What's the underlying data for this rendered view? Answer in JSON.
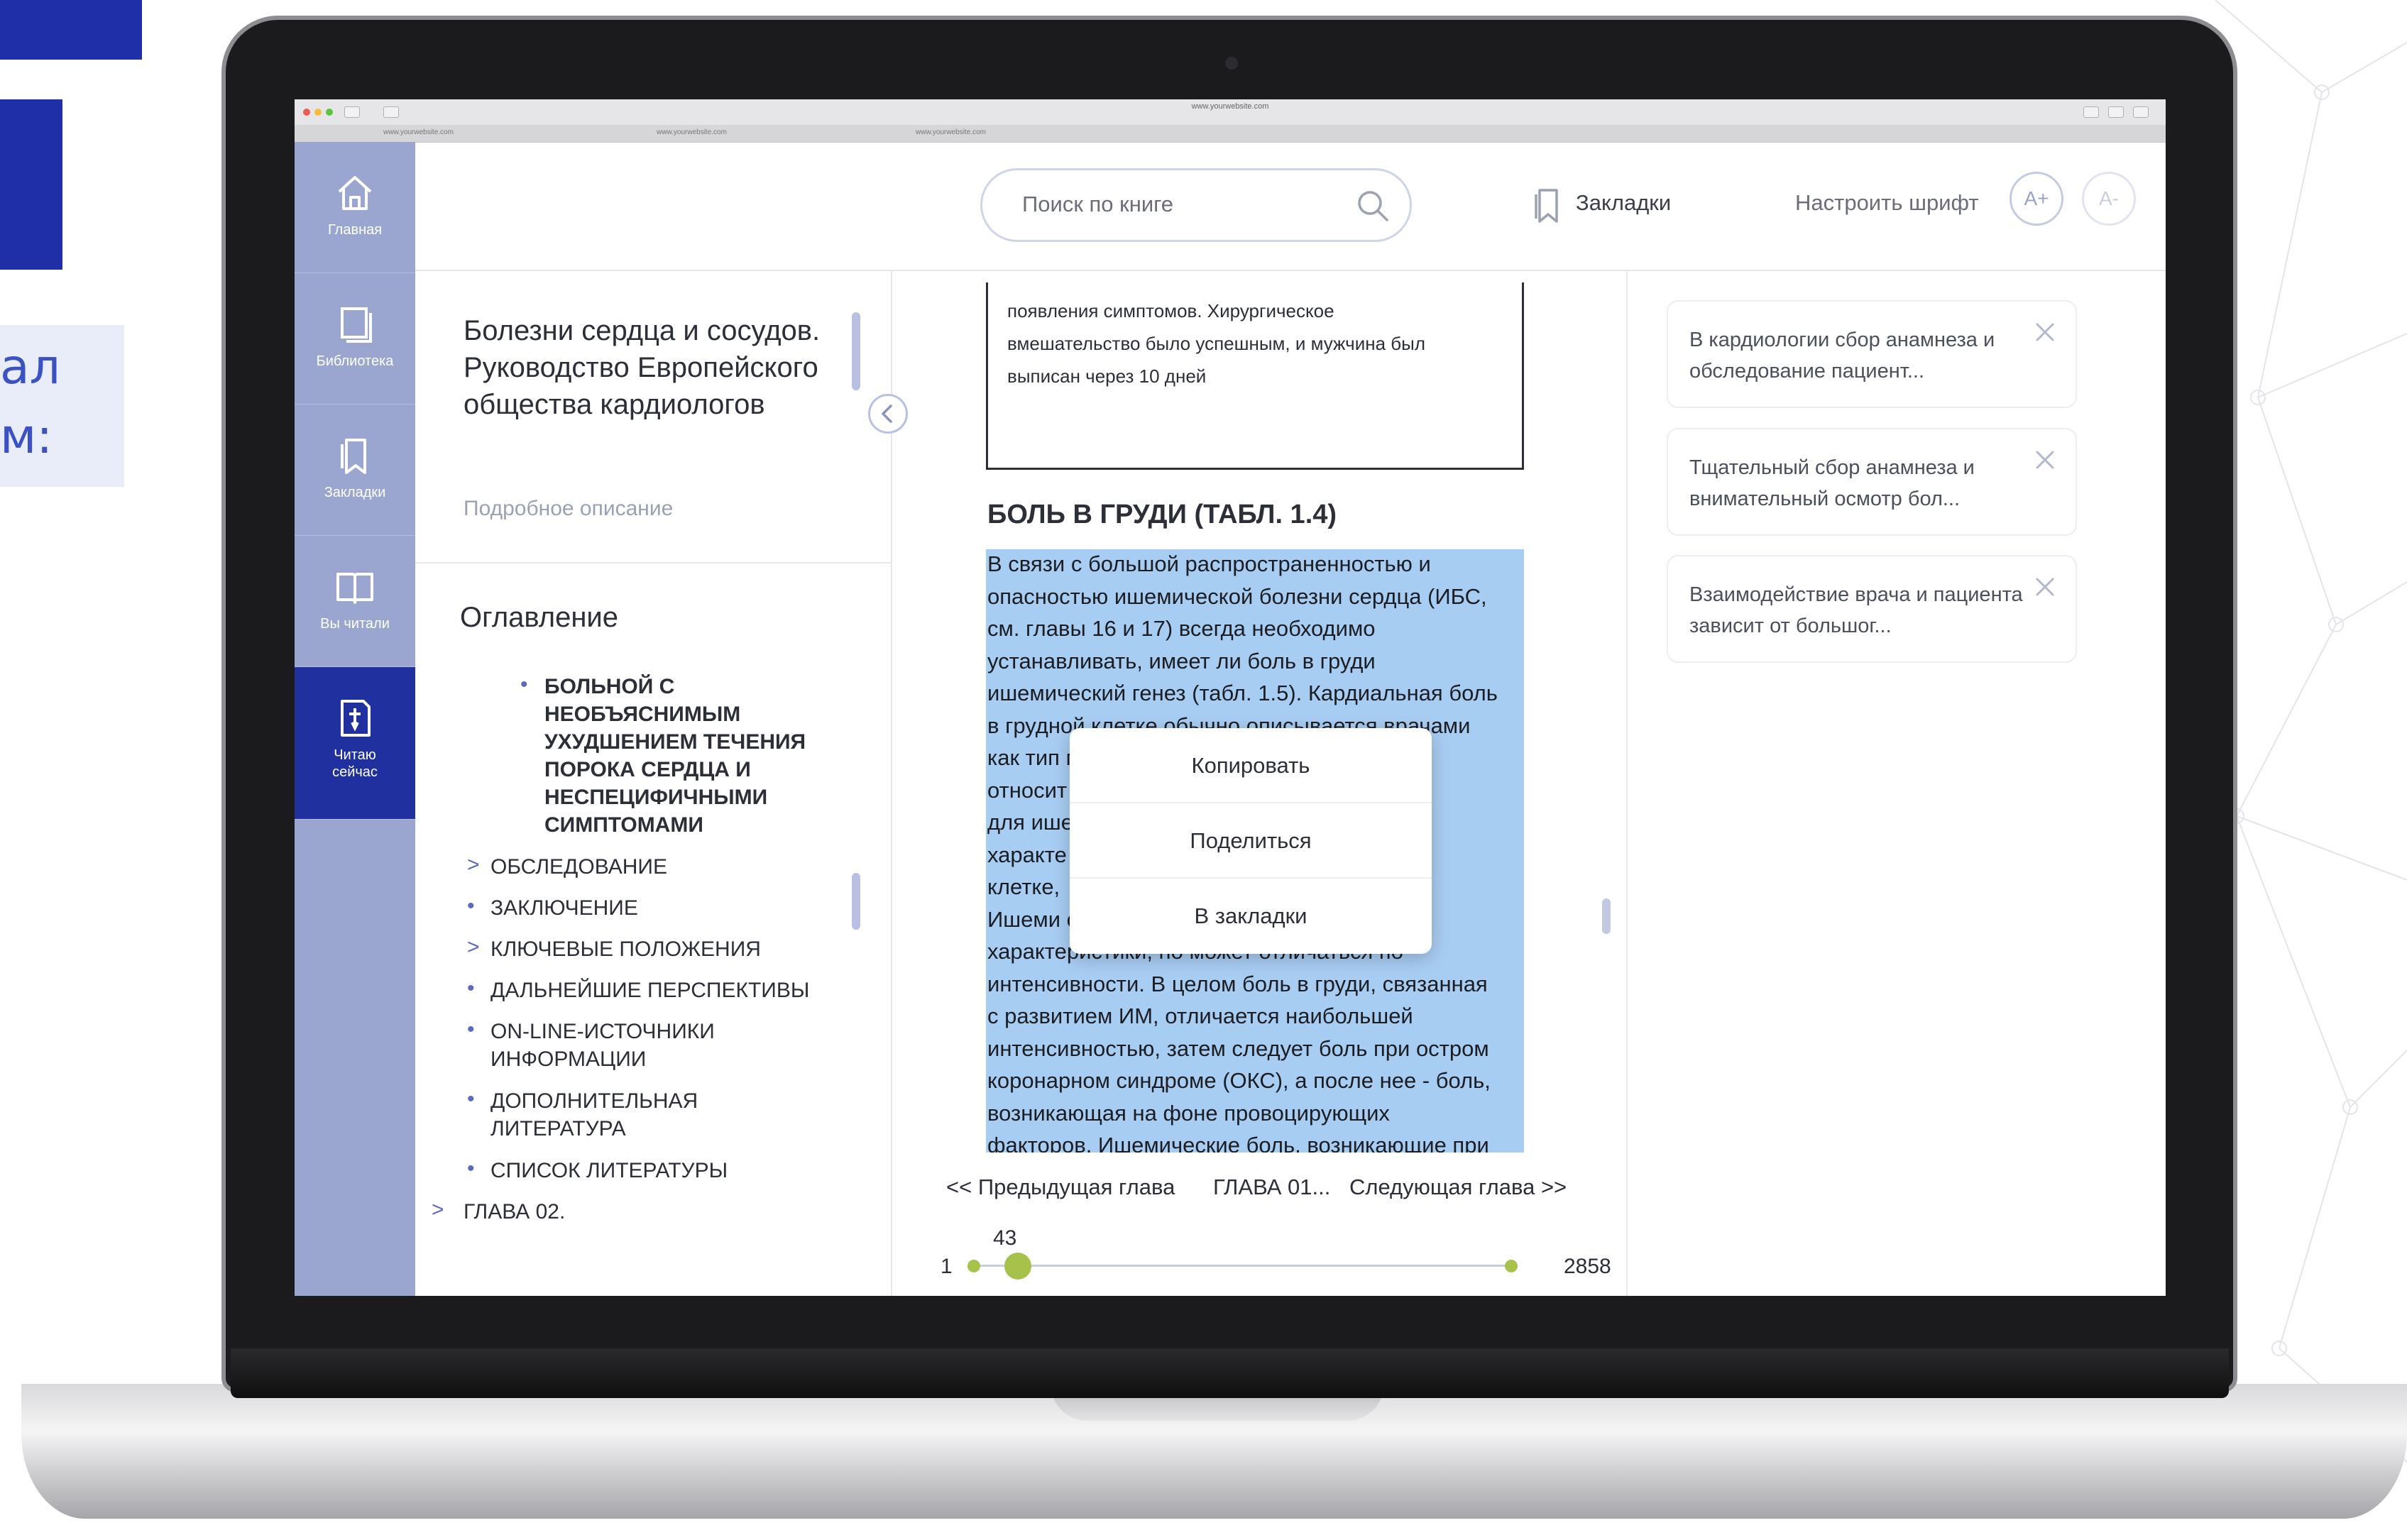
{
  "background": {
    "text_lines": [
      "ал",
      "м:"
    ]
  },
  "browser": {
    "url": "www.yourwebsite.com",
    "tabs": [
      "www.yourwebsite.com",
      "www.yourwebsite.com",
      "www.yourwebsite.com"
    ]
  },
  "nav": {
    "items": [
      {
        "label": "Главная",
        "icon": "home-icon"
      },
      {
        "label": "Библиотека",
        "icon": "library-icon"
      },
      {
        "label": "Закладки",
        "icon": "bookmark-icon"
      },
      {
        "label": "Вы читали",
        "icon": "open-book-icon"
      },
      {
        "label": "Читаю сейчас",
        "icon": "reading-now-icon",
        "active": true
      }
    ]
  },
  "header": {
    "search_placeholder": "Поиск по книге",
    "bookmarks_label": "Закладки",
    "font_label": "Настроить шрифт",
    "font_increase": "A+",
    "font_decrease": "A-"
  },
  "book": {
    "title": "Болезни сердца и сосудов. Руководство Европейского общества кардиологов",
    "description_link": "Подробное описание"
  },
  "toc": {
    "title": "Оглавление",
    "items": [
      {
        "label": "Больной с необъяснимым ухудшением течения порока сердца и неспецифичными симптомами",
        "marker": "•"
      },
      {
        "label": "Обследование",
        "marker": ">"
      },
      {
        "label": "Заключение",
        "marker": "•"
      },
      {
        "label": "Ключевые положения",
        "marker": ">"
      },
      {
        "label": "Дальнейшие перспективы",
        "marker": "•"
      },
      {
        "label": "On-line-источники информации",
        "marker": "•"
      },
      {
        "label": "Дополнительная литература",
        "marker": "•"
      },
      {
        "label": "Список литературы",
        "marker": "•"
      },
      {
        "label": "Глава 02.",
        "marker": ">"
      }
    ]
  },
  "reader": {
    "quote_lines": [
      "появления симптомов. Хирургическое",
      "вмешательство было успешным, и мужчина был",
      "выписан через 10 дней"
    ],
    "section_heading": "БОЛЬ В ГРУДИ (ТАБЛ. 1.4)",
    "body_lines": [
      "В связи с большой распространенностью и",
      "опасностью ишемической болезни сердца (ИБС,",
      "см. главы 16 и 17) всегда необходимо",
      "устанавливать, имеет ли боль в груди",
      "ишемический генез (табл. 1.5). Кардиальная боль",
      "в грудной клетке обычно описывается врачами",
      "как тип                                           пичная\"",
      "относит                                         рному",
      "для ише",
      "характе                                         рудной",
      "клетке,",
      "Ишеми                                           ожие",
      "характеристики, но может отличаться по",
      "интенсивности. В целом боль в груди, связанная",
      "с развитием ИМ, отличается наибольшей",
      "интенсивностью, затем следует боль при остром",
      "коронарном синдроме (ОКС), а после нее - боль,",
      "возникающая на фоне провоцирующих",
      "факторов. Ишемические боль, возникающие при"
    ],
    "context_menu": [
      "Копировать",
      "Поделиться",
      "В закладки"
    ],
    "prev_chapter": "<< Предыдущая глава",
    "current_chapter": "ГЛАВА 01...",
    "next_chapter": "Следующая глава >>",
    "page_current": "43",
    "page_first": "1",
    "page_last": "2858",
    "progress_fraction": 0.015
  },
  "bookmarks": [
    "В кардиологии сбор анамнеза и обследование пациент...",
    "Тщательный сбор анамнеза и внимательный осмотр бол...",
    "Взаимодействие врача и пациента зависит от большог..."
  ],
  "colors": {
    "brand": "#21309f",
    "nav_bg": "#9aa6cf",
    "highlight": "#a8cdf3",
    "slider": "#a7c24a"
  }
}
